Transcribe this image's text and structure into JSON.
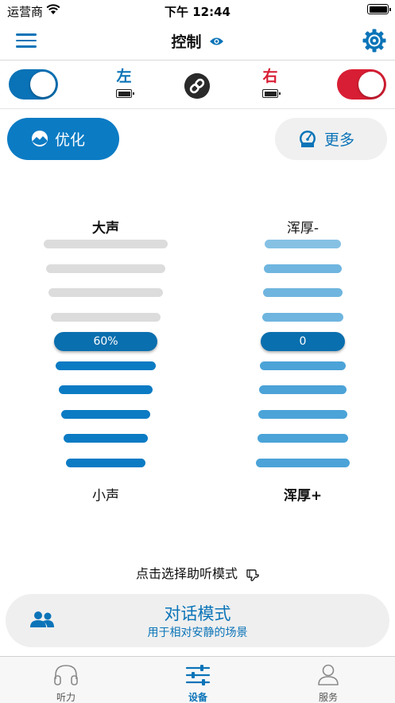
{
  "status_bar": {
    "carrier": "运营商",
    "time": "下午 12:44"
  },
  "nav": {
    "title": "控制"
  },
  "devices": {
    "left": {
      "label": "左",
      "enabled": true
    },
    "right": {
      "label": "右",
      "enabled": true
    }
  },
  "actions": {
    "optimize_label": "优化",
    "more_label": "更多"
  },
  "volume": {
    "top_label": "大声",
    "bottom_label": "小声",
    "value_label": "60%",
    "level_index": 4,
    "steps": 10
  },
  "bass": {
    "top_label": "浑厚-",
    "bottom_label": "浑厚+",
    "value_label": "0",
    "level_index": 4,
    "steps": 10
  },
  "hint": {
    "text": "点击选择助听模式"
  },
  "program": {
    "name": "对话模式",
    "description": "用于相对安静的场景"
  },
  "tabs": [
    {
      "label": "听力",
      "active": false
    },
    {
      "label": "设备",
      "active": true
    },
    {
      "label": "服务",
      "active": false
    }
  ],
  "colors": {
    "accent": "#0b7bc4",
    "left_side": "#0a72b6",
    "right_side": "#d81e34"
  }
}
